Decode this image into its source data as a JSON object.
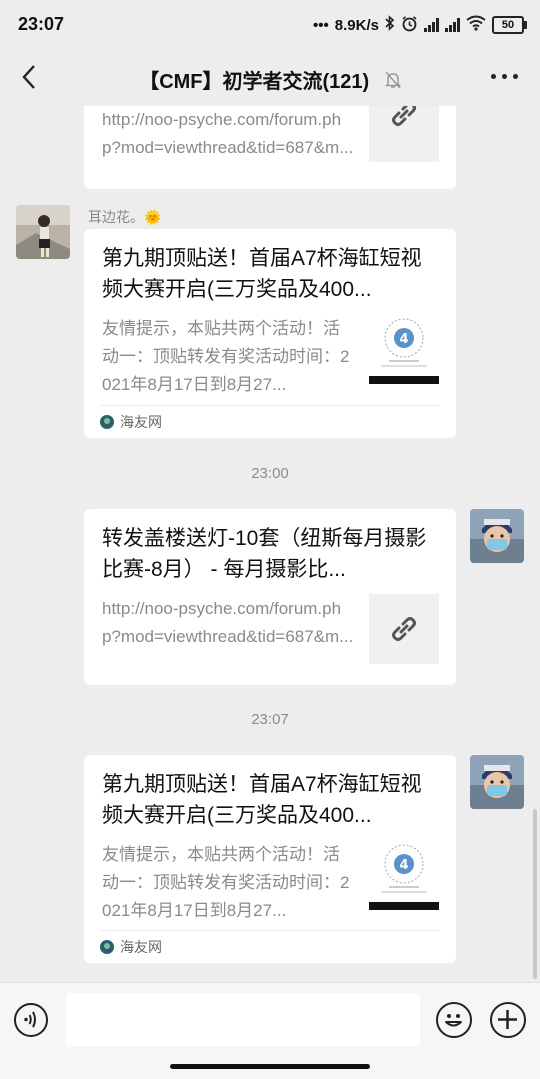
{
  "status_bar": {
    "time": "23:07",
    "network_speed": "8.9K/s",
    "battery_level": "50",
    "icons": [
      "dots-icon",
      "bluetooth-icon",
      "alarm-icon",
      "hd-signal-icon",
      "hd-signal-icon",
      "wifi-icon",
      "battery-icon"
    ]
  },
  "header": {
    "title": "【CMF】初学者交流(121)",
    "back_icon": "back-arrow-icon",
    "mute_icon": "bell-muted-icon",
    "more_icon": "more-dots-icon"
  },
  "messages": [
    {
      "type": "link",
      "side": "left",
      "partial": true,
      "desc": "http://noo-psyche.com/forum.php?mod=viewthread&tid=687&m..."
    },
    {
      "type": "article",
      "side": "left",
      "sender": "耳边花。🌞",
      "title": "第九期顶贴送！首届A7杯海缸短视频大赛开启(三万奖品及400...",
      "desc": "友情提示，本贴共两个活动！活动一：顶贴转发有奖活动时间：2021年8月17日到8月27...",
      "source": "海友网"
    },
    {
      "type": "time",
      "text": "23:00"
    },
    {
      "type": "link",
      "side": "right",
      "title": "转发盖楼送灯-10套（纽斯每月摄影比赛-8月） - 每月摄影比...",
      "desc": "http://noo-psyche.com/forum.php?mod=viewthread&tid=687&m..."
    },
    {
      "type": "time",
      "text": "23:07"
    },
    {
      "type": "article",
      "side": "right",
      "title": "第九期顶贴送！首届A7杯海缸短视频大赛开启(三万奖品及400...",
      "desc": "友情提示，本贴共两个活动！活动一：顶贴转发有奖活动时间：2021年8月17日到8月27...",
      "source": "海友网"
    }
  ],
  "input_bar": {
    "voice_icon": "voice-icon",
    "emoji_icon": "emoji-icon",
    "plus_icon": "plus-icon",
    "input_value": ""
  }
}
